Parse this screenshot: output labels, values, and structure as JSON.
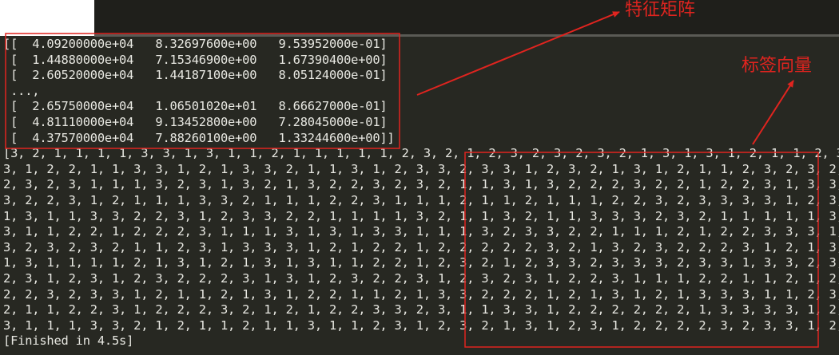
{
  "output_lines": [
    "[[  4.09200000e+04   8.32697600e+00   9.53952000e-01]",
    " [  1.44880000e+04   7.15346900e+00   1.67390400e+00]",
    " [  2.60520000e+04   1.44187100e+00   8.05124000e-01]",
    " ...,",
    " [  2.65750000e+04   1.06501020e+01   8.66627000e-01]",
    " [  4.81110000e+04   9.13452800e+00   7.28045000e-01]",
    " [  4.37570000e+04   7.88260100e+00   1.33244600e+00]]",
    "[3, 2, 1, 1, 1, 1, 3, 3, 1, 3, 1, 1, 2, 1, 1, 1, 1, 1, 2, 3, 2, 1, 2, 3, 2, 3, 2, 3, 2, 1, 3, 1, 3, 1, 2, 1, 1, 2, 3,",
    "3, 1, 2, 2, 1, 1, 3, 3, 1, 2, 1, 3, 3, 2, 1, 1, 3, 1, 2, 3, 3, 2, 3, 3, 1, 2, 3, 2, 1, 3, 1, 2, 1, 1, 2, 3, 2, 3, 2,",
    "2, 3, 2, 3, 1, 1, 1, 3, 2, 3, 1, 3, 2, 1, 3, 2, 2, 3, 2, 3, 2, 1, 1, 3, 1, 3, 2, 2, 2, 3, 2, 2, 1, 2, 2, 3, 1, 3, 3,",
    "3, 2, 2, 3, 1, 2, 1, 1, 1, 3, 3, 2, 1, 1, 1, 2, 2, 3, 1, 1, 1, 2, 1, 1, 2, 1, 1, 1, 2, 2, 3, 2, 3, 3, 3, 3, 1, 2, 3,",
    "1, 3, 1, 1, 3, 3, 2, 2, 3, 1, 2, 3, 3, 2, 2, 1, 1, 1, 1, 3, 2, 1, 1, 3, 2, 1, 1, 3, 3, 3, 2, 3, 2, 1, 1, 1, 1, 1, 3,",
    "3, 1, 1, 2, 2, 1, 2, 2, 2, 3, 1, 1, 1, 3, 1, 3, 1, 3, 3, 1, 1, 1, 3, 2, 3, 3, 2, 2, 1, 1, 1, 2, 1, 2, 2, 3, 3, 3, 1,",
    "3, 2, 3, 2, 3, 2, 1, 1, 2, 3, 1, 3, 3, 3, 1, 2, 1, 2, 2, 1, 2, 2, 2, 2, 2, 3, 2, 1, 3, 2, 3, 2, 2, 2, 3, 1, 2, 1, 3,",
    "1, 3, 1, 1, 1, 1, 2, 1, 3, 1, 2, 1, 3, 1, 3, 1, 1, 2, 2, 1, 2, 3, 2, 1, 2, 3, 3, 2, 3, 3, 3, 2, 3, 3, 1, 3, 3, 2, 3,",
    "2, 3, 1, 2, 3, 1, 2, 3, 2, 2, 2, 3, 1, 3, 1, 2, 3, 2, 2, 3, 1, 2, 3, 2, 3, 1, 2, 2, 3, 1, 1, 1, 2, 2, 1, 1, 2, 1, 2,",
    "2, 2, 3, 2, 3, 3, 1, 2, 1, 1, 2, 1, 3, 1, 2, 2, 1, 1, 2, 1, 3, 3, 2, 2, 2, 1, 2, 1, 3, 1, 2, 1, 3, 3, 3, 1, 1, 2, 3,",
    "2, 1, 1, 2, 2, 3, 1, 2, 2, 2, 3, 2, 1, 2, 1, 2, 2, 3, 3, 2, 3, 1, 1, 3, 3, 1, 2, 2, 2, 2, 2, 2, 1, 3, 3, 3, 3, 1, 2,",
    "3, 1, 1, 1, 3, 3, 2, 1, 2, 1, 1, 2, 1, 1, 3, 1, 1, 2, 3, 1, 2, 3, 2, 1, 3, 1, 2, 3, 1, 2, 2, 2, 2, 3, 2, 3, 3, 1, 2,",
    "[Finished in 4.5s]"
  ],
  "annotations": {
    "feature_matrix_label": "特征矩阵",
    "label_vector_label": "标签向量",
    "color": "#e0241f"
  }
}
